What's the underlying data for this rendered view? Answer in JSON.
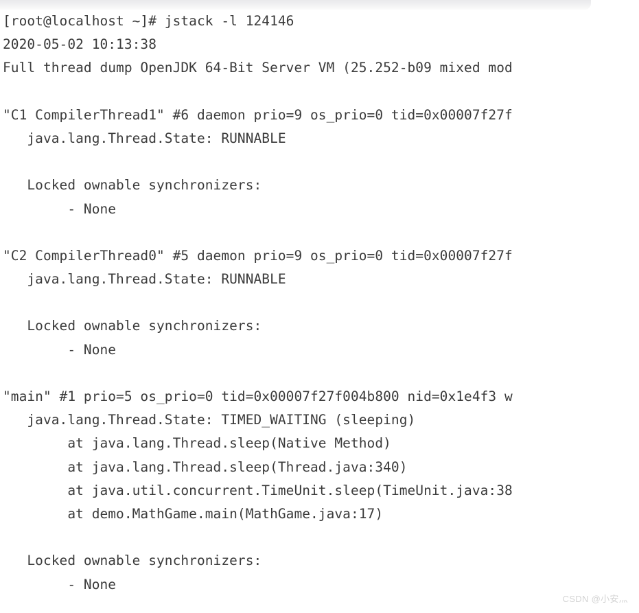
{
  "window": {
    "top_bar_present": true
  },
  "terminal": {
    "prompt_line": "[root@localhost ~]# jstack -l 124146",
    "lines": [
      "[root@localhost ~]# jstack -l 124146",
      "2020-05-02 10:13:38",
      "Full thread dump OpenJDK 64-Bit Server VM (25.252-b09 mixed mod",
      "",
      "\"C1 CompilerThread1\" #6 daemon prio=9 os_prio=0 tid=0x00007f27f",
      "   java.lang.Thread.State: RUNNABLE",
      "",
      "   Locked ownable synchronizers:",
      "        - None",
      "",
      "\"C2 CompilerThread0\" #5 daemon prio=9 os_prio=0 tid=0x00007f27f",
      "   java.lang.Thread.State: RUNNABLE",
      "",
      "   Locked ownable synchronizers:",
      "        - None",
      "",
      "\"main\" #1 prio=5 os_prio=0 tid=0x00007f27f004b800 nid=0x1e4f3 w",
      "   java.lang.Thread.State: TIMED_WAITING (sleeping)",
      "        at java.lang.Thread.sleep(Native Method)",
      "        at java.lang.Thread.sleep(Thread.java:340)",
      "        at java.util.concurrent.TimeUnit.sleep(TimeUnit.java:38",
      "        at demo.MathGame.main(MathGame.java:17)",
      "",
      "   Locked ownable synchronizers:",
      "        - None",
      "..."
    ],
    "command": "jstack -l 124146",
    "pid": "124146",
    "timestamp": "2020-05-02 10:13:38",
    "jvm_banner": "Full thread dump OpenJDK 64-Bit Server VM (25.252-b09 mixed mod",
    "threads": [
      {
        "name": "C1 CompilerThread1",
        "id": "#6",
        "daemon": "daemon",
        "prio": "9",
        "os_prio": "0",
        "tid": "0x00007f27f",
        "state": "RUNNABLE",
        "locked_ownable_synchronizers": "None"
      },
      {
        "name": "C2 CompilerThread0",
        "id": "#5",
        "daemon": "daemon",
        "prio": "9",
        "os_prio": "0",
        "tid": "0x00007f27f",
        "state": "RUNNABLE",
        "locked_ownable_synchronizers": "None"
      },
      {
        "name": "main",
        "id": "#1",
        "daemon": "",
        "prio": "5",
        "os_prio": "0",
        "tid": "0x00007f27f004b800",
        "nid": "0x1e4f3",
        "state": "TIMED_WAITING (sleeping)",
        "stack": [
          "at java.lang.Thread.sleep(Native Method)",
          "at java.lang.Thread.sleep(Thread.java:340)",
          "at java.util.concurrent.TimeUnit.sleep(TimeUnit.java:38",
          "at demo.MathGame.main(MathGame.java:17)"
        ],
        "locked_ownable_synchronizers": "None"
      }
    ],
    "truncation_marker": "..."
  },
  "watermark": {
    "text": "CSDN @小安灬"
  },
  "colors": {
    "text": "#3b3b3b",
    "background": "#ffffff",
    "top_bar": "#ebebed",
    "watermark": "#d3d3d3"
  }
}
